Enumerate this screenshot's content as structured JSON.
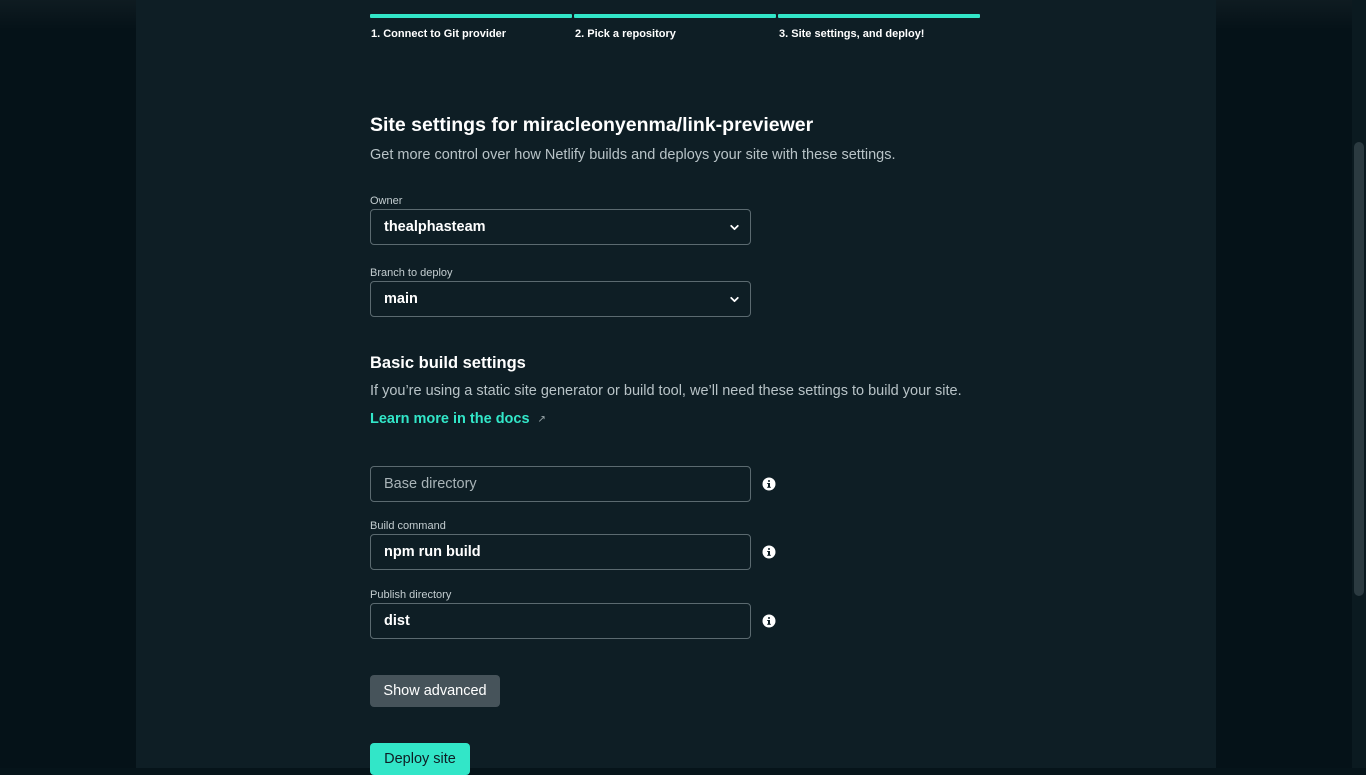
{
  "steps": [
    {
      "label": "1. Connect to Git provider"
    },
    {
      "label": "2. Pick a repository"
    },
    {
      "label": "3. Site settings, and deploy!"
    }
  ],
  "header": {
    "title": "Site settings for miracleonyenma/link-previewer",
    "subtitle": "Get more control over how Netlify builds and deploys your site with these settings."
  },
  "owner": {
    "label": "Owner",
    "value": "thealphasteam"
  },
  "branch": {
    "label": "Branch to deploy",
    "value": "main"
  },
  "build_settings": {
    "title": "Basic build settings",
    "description": "If you’re using a static site generator or build tool, we’ll need these settings to build your site.",
    "docs_link": "Learn more in the docs",
    "docs_link_icon": "↗"
  },
  "base_directory": {
    "placeholder": "Base directory"
  },
  "build_command": {
    "label": "Build command",
    "value": "npm run build"
  },
  "publish_directory": {
    "label": "Publish directory",
    "value": "dist"
  },
  "buttons": {
    "show_advanced": "Show advanced",
    "deploy": "Deploy site"
  },
  "colors": {
    "accent": "#32e6c8",
    "panel_bg": "#0e1e25",
    "page_bg": "#051218"
  }
}
